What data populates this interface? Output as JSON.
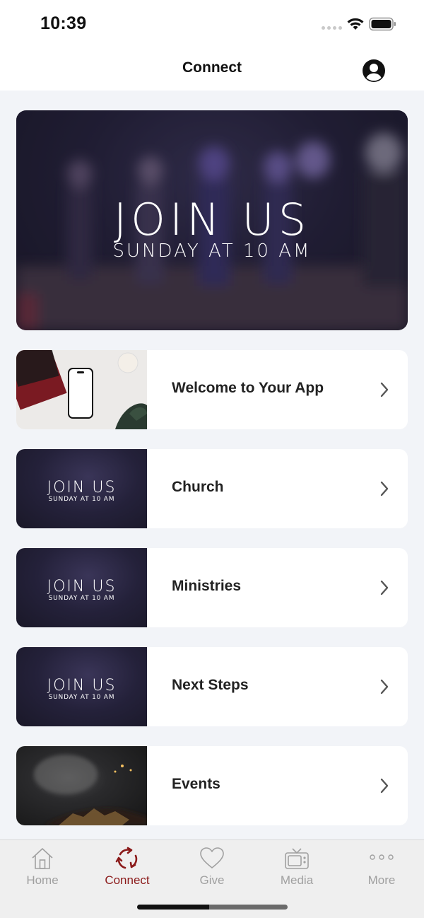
{
  "status_bar": {
    "time": "10:39"
  },
  "navbar": {
    "title": "Connect",
    "profile_icon": "person-circle-icon"
  },
  "hero": {
    "line1": "JOIN US",
    "line2": "SUNDAY AT 10 AM"
  },
  "cards": [
    {
      "label": "Welcome to Your App",
      "thumb": "desk-phone-photo"
    },
    {
      "label": "Church",
      "thumb": "join-us-banner",
      "thumb_line1": "JOIN US",
      "thumb_line2": "SUNDAY AT 10 AM"
    },
    {
      "label": "Ministries",
      "thumb": "join-us-banner",
      "thumb_line1": "JOIN US",
      "thumb_line2": "SUNDAY AT 10 AM"
    },
    {
      "label": "Next Steps",
      "thumb": "join-us-banner",
      "thumb_line1": "JOIN US",
      "thumb_line2": "SUNDAY AT 10 AM"
    },
    {
      "label": "Events",
      "thumb": "crowd-hands-photo"
    }
  ],
  "tabbar": {
    "tabs": [
      {
        "label": "Home",
        "icon": "home-icon",
        "active": false
      },
      {
        "label": "Connect",
        "icon": "connect-icon",
        "active": true
      },
      {
        "label": "Give",
        "icon": "heart-icon",
        "active": false
      },
      {
        "label": "Media",
        "icon": "tv-icon",
        "active": false
      },
      {
        "label": "More",
        "icon": "more-icon",
        "active": false
      }
    ]
  },
  "colors": {
    "accent": "#8b1a1a",
    "inactive": "#a0a0a0",
    "background": "#f2f4f8"
  }
}
